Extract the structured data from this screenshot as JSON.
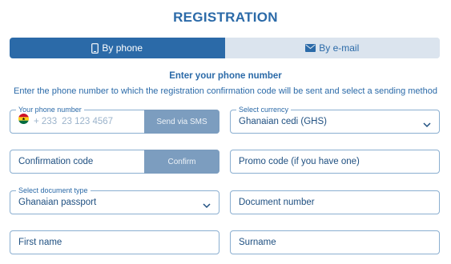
{
  "title": "REGISTRATION",
  "tabs": [
    {
      "label": "By phone",
      "icon": "phone-icon",
      "active": true
    },
    {
      "label": "By e-mail",
      "icon": "envelope-icon",
      "active": false
    }
  ],
  "subtitle": "Enter your phone number",
  "description": "Enter the phone number to which the registration confirmation code will be sent and select a sending method",
  "phone": {
    "legend": "Your phone number",
    "prefix": "+ 233",
    "placeholder": "23 123 4567",
    "button": "Send via SMS"
  },
  "currency": {
    "legend": "Select currency",
    "value": "Ghanaian cedi (GHS)"
  },
  "confirmation": {
    "placeholder": "Confirmation code",
    "button": "Confirm"
  },
  "promo": {
    "placeholder": "Promo code (if you have one)"
  },
  "document_type": {
    "legend": "Select document type",
    "value": "Ghanaian passport"
  },
  "document_number": {
    "placeholder": "Document number"
  },
  "first_name": {
    "placeholder": "First name"
  },
  "surname": {
    "placeholder": "Surname"
  },
  "colors": {
    "accent": "#2b6aa8",
    "tab_inactive": "#dbe4ee",
    "button_disabled": "#7c9dbf",
    "border": "#8aaed0"
  }
}
